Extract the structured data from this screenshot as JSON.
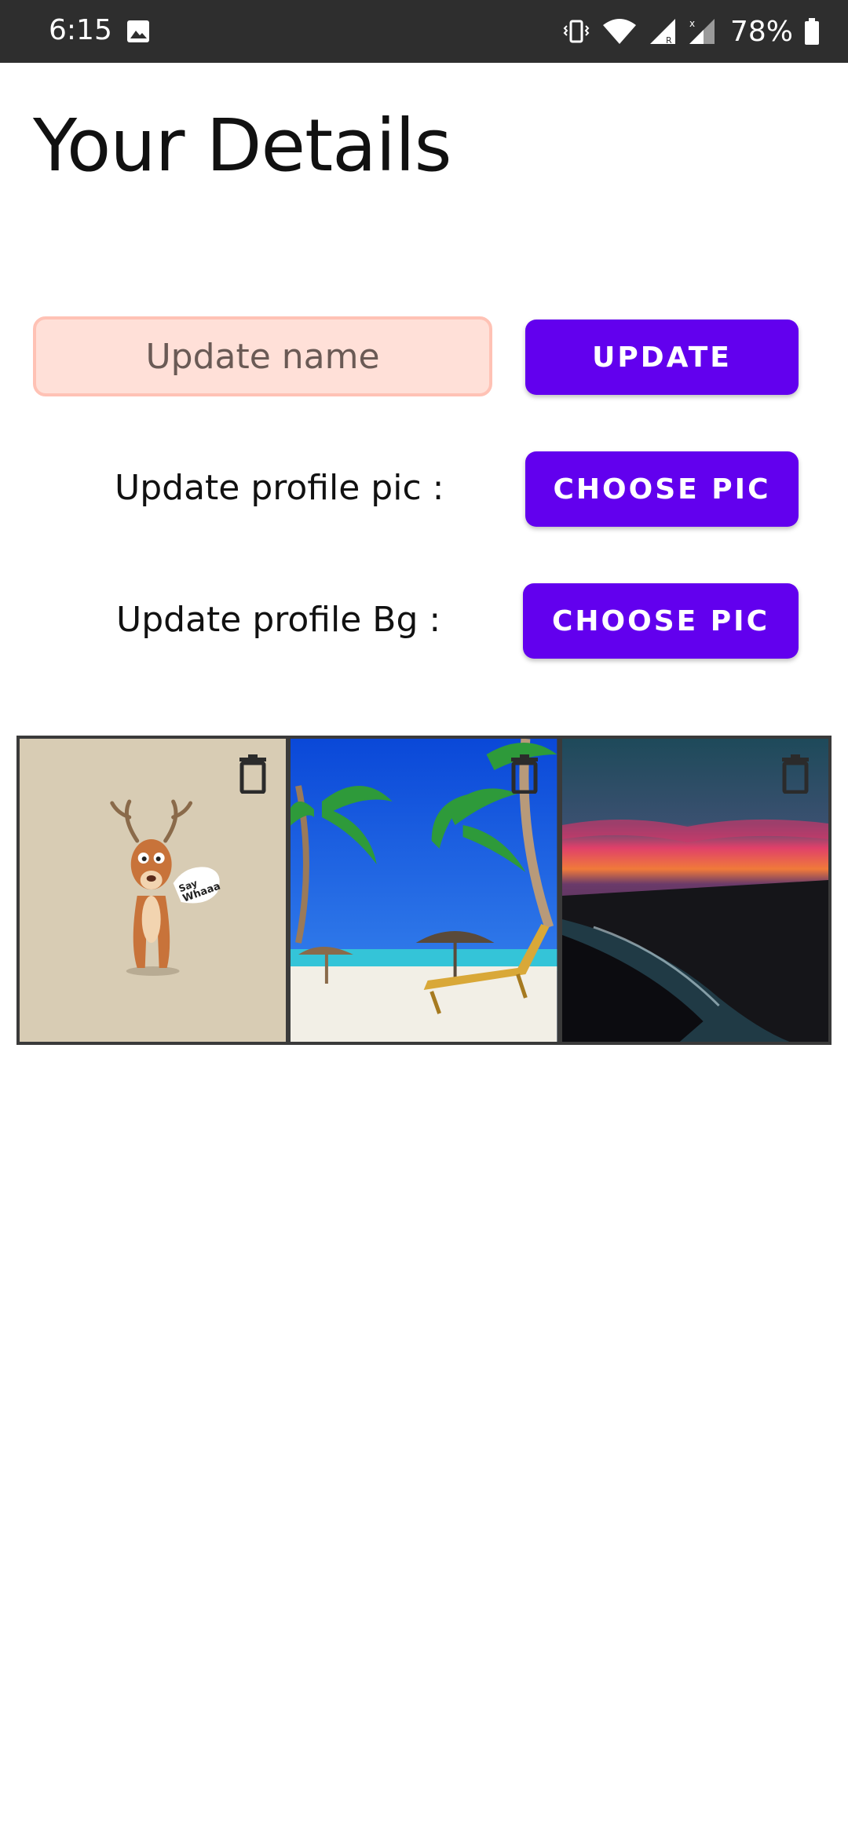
{
  "status_bar": {
    "time": "6:15",
    "battery": "78%",
    "icons": [
      "gallery-icon",
      "vibrate-icon",
      "wifi-icon",
      "signal-icon",
      "signal-icon",
      "battery-icon"
    ]
  },
  "page": {
    "title": "Your Details"
  },
  "name_form": {
    "placeholder": "Update name",
    "update_button": "UPDATE"
  },
  "profile_pic": {
    "label": "Update profile pic :",
    "button": "CHOOSE PIC"
  },
  "profile_bg": {
    "label": "Update profile Bg :",
    "button": "CHOOSE PIC"
  },
  "gallery": {
    "items": [
      {
        "content": "cartoon-deer",
        "sticker": "Say Whaaa",
        "icon": "trash-icon"
      },
      {
        "content": "tropical-beach",
        "icon": "trash-icon"
      },
      {
        "content": "sunset-shore",
        "icon": "trash-icon"
      }
    ]
  },
  "colors": {
    "accent": "#6200ee",
    "field_bg": "#ffe0d8",
    "status_bar": "#2e2e2e"
  }
}
